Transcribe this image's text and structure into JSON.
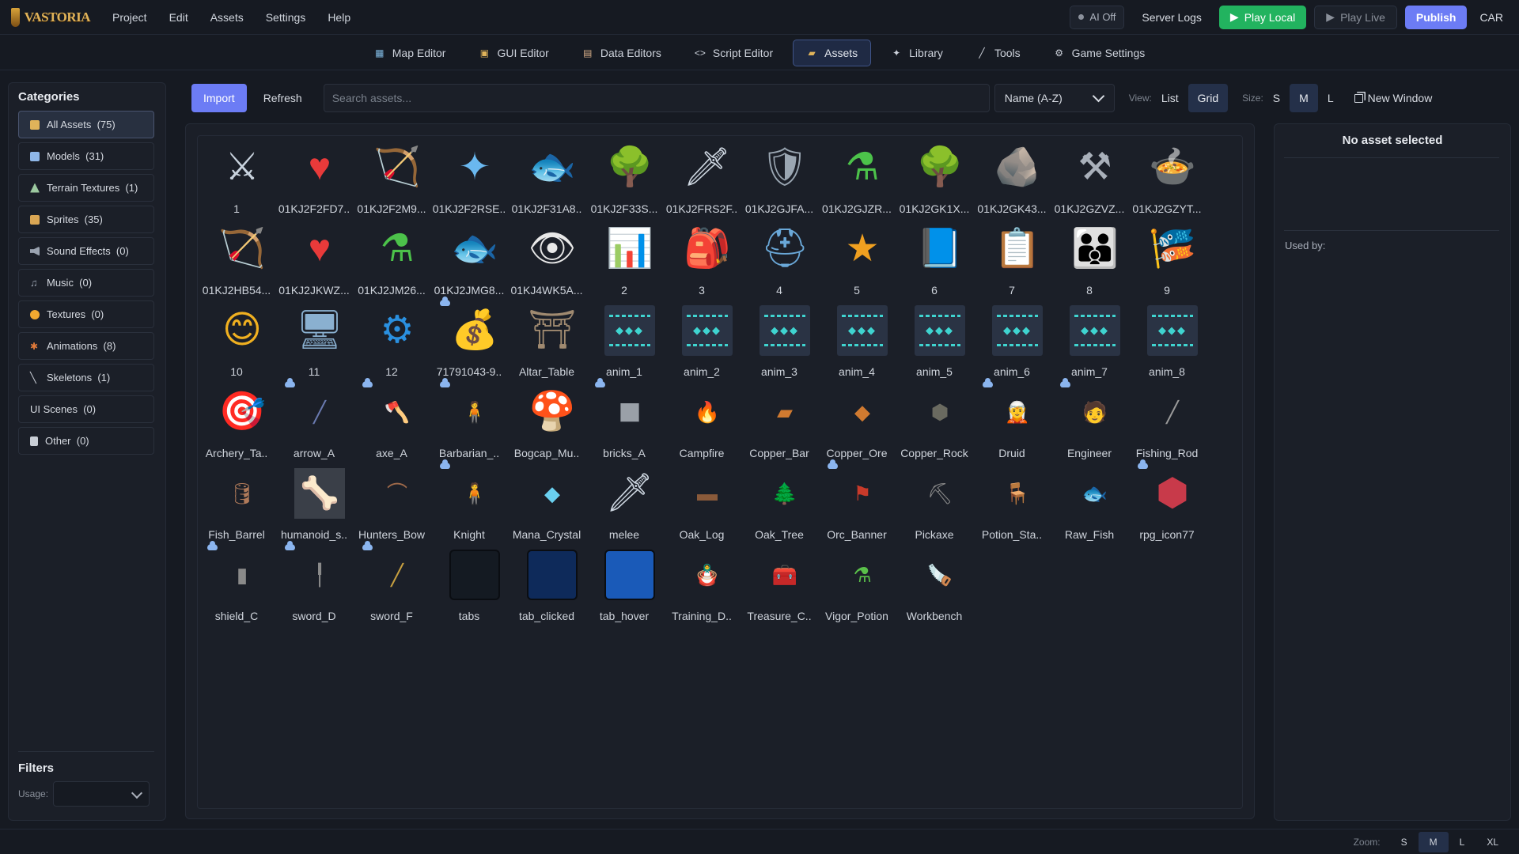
{
  "app": {
    "logo_text": "VASTORIA"
  },
  "menu": [
    "Project",
    "Edit",
    "Assets",
    "Settings",
    "Help"
  ],
  "right_menu": {
    "ai_toggle": "AI Off",
    "server_logs": "Server Logs",
    "play_local": "Play Local",
    "play_live": "Play Live",
    "publish": "Publish",
    "user": "CAR"
  },
  "tabs": [
    {
      "label": "Map Editor",
      "icon": "map-icon"
    },
    {
      "label": "GUI Editor",
      "icon": "gui-icon"
    },
    {
      "label": "Data Editors",
      "icon": "database-icon"
    },
    {
      "label": "Script Editor",
      "icon": "code-icon"
    },
    {
      "label": "Assets",
      "icon": "folder-icon",
      "active": true
    },
    {
      "label": "Library",
      "icon": "sparkle-icon"
    },
    {
      "label": "Tools",
      "icon": "wrench-icon"
    },
    {
      "label": "Game Settings",
      "icon": "gear-icon"
    }
  ],
  "sidebar": {
    "title": "Categories",
    "categories": [
      {
        "label": "All Assets  (75)",
        "icon": "folder-icon",
        "active": true,
        "color": "#e0b35a"
      },
      {
        "label": "Models  (31)",
        "icon": "cube-icon",
        "color": "#8fb7e8"
      },
      {
        "label": "Terrain Textures  (1)",
        "icon": "mountain-icon",
        "color": "#9cc9a0"
      },
      {
        "label": "Sprites  (35)",
        "icon": "image-icon",
        "color": "#d9a654"
      },
      {
        "label": "Sound Effects  (0)",
        "icon": "speaker-icon",
        "color": "#9aa3b0"
      },
      {
        "label": "Music  (0)",
        "icon": "music-icon",
        "color": "#9aa3b0"
      },
      {
        "label": "Textures  (0)",
        "icon": "palette-icon",
        "color": "#f0a830"
      },
      {
        "label": "Animations  (8)",
        "icon": "runner-icon",
        "color": "#e07a3a"
      },
      {
        "label": "Skeletons  (1)",
        "icon": "bone-icon",
        "color": "#c9ced6"
      },
      {
        "label": "UI Scenes  (0)",
        "icon": "",
        "color": ""
      },
      {
        "label": "Other  (0)",
        "icon": "document-icon",
        "color": "#c9ced6"
      }
    ],
    "filters_title": "Filters",
    "usage_label": "Usage:"
  },
  "asset_toolbar": {
    "import": "Import",
    "refresh": "Refresh",
    "search_placeholder": "Search assets...",
    "sort": "Name (A-Z)",
    "view_label": "View:",
    "view_list": "List",
    "view_grid": "Grid",
    "size_label": "Size:",
    "size_s": "S",
    "size_m": "M",
    "size_l": "L",
    "new_window": "New Window"
  },
  "assets": [
    {
      "name": "1",
      "icon": "crossed-swords-icon",
      "glyph": "⚔",
      "color": "#c9d3de"
    },
    {
      "name": "01KJ2F2FD7..",
      "icon": "heart-icon",
      "glyph": "♥",
      "color": "#e83a3a"
    },
    {
      "name": "01KJ2F2M9...",
      "icon": "bow-icon",
      "glyph": "🏹",
      "color": "#b07a3a"
    },
    {
      "name": "01KJ2F2RSE..",
      "icon": "magic-wand-icon",
      "glyph": "✦",
      "color": "#6ab8f0"
    },
    {
      "name": "01KJ2F31A8..",
      "icon": "fish-icon",
      "glyph": "🐟",
      "color": "#5aa8e8"
    },
    {
      "name": "01KJ2F33S...",
      "icon": "tree-icon",
      "glyph": "🌳",
      "color": "#4ca43e"
    },
    {
      "name": "01KJ2FRS2F..",
      "icon": "sword-icon",
      "glyph": "🗡",
      "color": "#cfd8e2"
    },
    {
      "name": "01KJ2GJFA...",
      "icon": "shield-icon",
      "glyph": "🛡",
      "color": "#9aa6b2"
    },
    {
      "name": "01KJ2GJZR...",
      "icon": "potion-icon",
      "glyph": "⚗",
      "color": "#4cc24a"
    },
    {
      "name": "01KJ2GK1X...",
      "icon": "tree-icon",
      "glyph": "🌳",
      "color": "#4ca43e"
    },
    {
      "name": "01KJ2GK43...",
      "icon": "ore-rock-icon",
      "glyph": "🪨",
      "color": "#9a8a7a"
    },
    {
      "name": "01KJ2GZVZ...",
      "icon": "hammer-icon",
      "glyph": "⚒",
      "color": "#a9b0ba"
    },
    {
      "name": "01KJ2GZYT...",
      "icon": "cauldron-icon",
      "glyph": "🍲",
      "color": "#3a3a3a"
    },
    {
      "name": "01KJ2HB54...",
      "icon": "bow-icon",
      "glyph": "🏹",
      "color": "#b07a3a"
    },
    {
      "name": "01KJ2JKWZ...",
      "icon": "heart-icon",
      "glyph": "♥",
      "color": "#e83a3a"
    },
    {
      "name": "01KJ2JM26...",
      "icon": "potion-icon",
      "glyph": "⚗",
      "color": "#4cc24a"
    },
    {
      "name": "01KJ2JMG8...",
      "icon": "fish-icon",
      "glyph": "🐟",
      "color": "#5aa8e8"
    },
    {
      "name": "01KJ4WK5A...",
      "icon": "eye-icon",
      "glyph": "👁",
      "color": "#e8e8e8"
    },
    {
      "name": "2",
      "icon": "bar-chart-icon",
      "glyph": "📊",
      "color": "#e8a020"
    },
    {
      "name": "3",
      "icon": "backpack-icon",
      "glyph": "🎒",
      "color": "#c47a30"
    },
    {
      "name": "4",
      "icon": "helmet-icon",
      "glyph": "⛑",
      "color": "#6aa8d8"
    },
    {
      "name": "5",
      "icon": "star-icon",
      "glyph": "★",
      "color": "#f0a020"
    },
    {
      "name": "6",
      "icon": "spellbook-icon",
      "glyph": "📘",
      "color": "#2a78d0"
    },
    {
      "name": "7",
      "icon": "checklist-icon",
      "glyph": "📋",
      "color": "#f0c040"
    },
    {
      "name": "8",
      "icon": "group-icon",
      "glyph": "👪",
      "color": "#e06a2a"
    },
    {
      "name": "9",
      "icon": "banner-icon",
      "glyph": "🎏",
      "color": "#c83a2a"
    },
    {
      "name": "10",
      "icon": "chat-smile-icon",
      "glyph": "😊",
      "color": "#f0b020"
    },
    {
      "name": "11",
      "icon": "monitor-icon",
      "glyph": "🖥",
      "color": "#8ab0d0"
    },
    {
      "name": "12",
      "icon": "gear-icon",
      "glyph": "⚙",
      "color": "#2a90e0"
    },
    {
      "name": "71791043-9..",
      "icon": "coin-bag-icon",
      "glyph": "💰",
      "color": "#c8902a",
      "cloud": true
    },
    {
      "name": "Altar_Table",
      "icon": "altar-icon",
      "glyph": "⛩",
      "color": "#a08a70"
    },
    {
      "name": "anim_1",
      "icon": "animation-card-icon",
      "card": true
    },
    {
      "name": "anim_2",
      "icon": "animation-card-icon",
      "card": true
    },
    {
      "name": "anim_3",
      "icon": "animation-card-icon",
      "card": true
    },
    {
      "name": "anim_4",
      "icon": "animation-card-icon",
      "card": true
    },
    {
      "name": "anim_5",
      "icon": "animation-card-icon",
      "card": true
    },
    {
      "name": "anim_6",
      "icon": "animation-card-icon",
      "card": true
    },
    {
      "name": "anim_7",
      "icon": "animation-card-icon",
      "card": true
    },
    {
      "name": "anim_8",
      "icon": "animation-card-icon",
      "card": true
    },
    {
      "name": "Archery_Ta..",
      "icon": "target-icon",
      "glyph": "🎯",
      "color": "#e04a4a"
    },
    {
      "name": "arrow_A",
      "icon": "arrow-icon",
      "glyph": "╱",
      "color": "#6a7ab0",
      "small": true,
      "cloud": true
    },
    {
      "name": "axe_A",
      "icon": "axe-icon",
      "glyph": "🪓",
      "color": "#8a8a8a",
      "small": true,
      "cloud": true
    },
    {
      "name": "Barbarian_..",
      "icon": "barbarian-icon",
      "glyph": "🧍",
      "color": "#8a7a6a",
      "small": true,
      "cloud": true
    },
    {
      "name": "Bogcap_Mu..",
      "icon": "mushroom-icon",
      "glyph": "🍄",
      "color": "#e04a3a"
    },
    {
      "name": "bricks_A",
      "icon": "cube-icon",
      "glyph": "■",
      "color": "#9aa0a8",
      "cloud": true
    },
    {
      "name": "Campfire",
      "icon": "campfire-icon",
      "glyph": "🔥",
      "color": "#b06a4a",
      "small": true
    },
    {
      "name": "Copper_Bar",
      "icon": "ingot-icon",
      "glyph": "▰",
      "color": "#d07a30",
      "small": true
    },
    {
      "name": "Copper_Ore",
      "icon": "ore-icon",
      "glyph": "◆",
      "color": "#d07a30",
      "small": true
    },
    {
      "name": "Copper_Rock",
      "icon": "rock-icon",
      "glyph": "⬢",
      "color": "#6a6a60",
      "small": true
    },
    {
      "name": "Druid",
      "icon": "druid-icon",
      "glyph": "🧝",
      "color": "#8a9a5a",
      "small": true,
      "cloud": true
    },
    {
      "name": "Engineer",
      "icon": "engineer-icon",
      "glyph": "🧑",
      "color": "#d08a40",
      "small": true,
      "cloud": true
    },
    {
      "name": "Fishing_Rod",
      "icon": "fishing-rod-icon",
      "glyph": "╱",
      "color": "#9a9a9a",
      "small": true
    },
    {
      "name": "Fish_Barrel",
      "icon": "barrel-icon",
      "glyph": "🛢",
      "color": "#b07a5a",
      "small": true
    },
    {
      "name": "humanoid_s..",
      "icon": "bone-icon",
      "glyph": "🦴",
      "color": "#e8e8e8",
      "boxed": true
    },
    {
      "name": "Hunters_Bow",
      "icon": "bow-icon",
      "glyph": "⌒",
      "color": "#a06a4a",
      "small": true
    },
    {
      "name": "Knight",
      "icon": "knight-icon",
      "glyph": "🧍",
      "color": "#9aa0a8",
      "small": true,
      "cloud": true
    },
    {
      "name": "Mana_Crystal",
      "icon": "crystal-icon",
      "glyph": "◆",
      "color": "#6ad0f0",
      "small": true
    },
    {
      "name": "melee",
      "icon": "sword-icon",
      "glyph": "🗡",
      "color": "#cfd8e2"
    },
    {
      "name": "Oak_Log",
      "icon": "log-icon",
      "glyph": "▬",
      "color": "#8a5a3a",
      "small": true
    },
    {
      "name": "Oak_Tree",
      "icon": "tree-icon",
      "glyph": "🌲",
      "color": "#4a9a4a",
      "small": true
    },
    {
      "name": "Orc_Banner",
      "icon": "banner-icon",
      "glyph": "⚑",
      "color": "#c83a2a",
      "small": true,
      "cloud": true
    },
    {
      "name": "Pickaxe",
      "icon": "pickaxe-icon",
      "glyph": "⛏",
      "color": "#8a8a8a",
      "small": true
    },
    {
      "name": "Potion_Sta..",
      "icon": "potion-stand-icon",
      "glyph": "🪑",
      "color": "#a06a4a",
      "small": true
    },
    {
      "name": "Raw_Fish",
      "icon": "fish-icon",
      "glyph": "🐟",
      "color": "#d0d8e0",
      "small": true
    },
    {
      "name": "rpg_icon77",
      "icon": "gem-icon",
      "glyph": "⬢",
      "color": "#c83a4a",
      "cloud": true
    },
    {
      "name": "shield_C",
      "icon": "shield-icon",
      "glyph": "▮",
      "color": "#8a8a8a",
      "small": true,
      "cloud": true
    },
    {
      "name": "sword_D",
      "icon": "sword-icon",
      "glyph": "╿",
      "color": "#8a8a8a",
      "small": true,
      "cloud": true
    },
    {
      "name": "sword_F",
      "icon": "sword-icon",
      "glyph": "╱",
      "color": "#c8a040",
      "small": true,
      "cloud": true
    },
    {
      "name": "tabs",
      "icon": "tab-swatch-icon",
      "swatch": "#141a22"
    },
    {
      "name": "tab_clicked",
      "icon": "tab-swatch-icon",
      "swatch": "#0e2a5a"
    },
    {
      "name": "tab_hover",
      "icon": "tab-swatch-icon",
      "swatch": "#1a5ab8"
    },
    {
      "name": "Training_D..",
      "icon": "training-dummy-icon",
      "glyph": "🪆",
      "color": "#d0b080",
      "small": true
    },
    {
      "name": "Treasure_C..",
      "icon": "chest-icon",
      "glyph": "🧰",
      "color": "#a08070",
      "small": true
    },
    {
      "name": "Vigor_Potion",
      "icon": "potion-icon",
      "glyph": "⚗",
      "color": "#5ac04a",
      "small": true
    },
    {
      "name": "Workbench",
      "icon": "workbench-icon",
      "glyph": "🪚",
      "color": "#a07a5a",
      "small": true
    }
  ],
  "detail": {
    "title": "No asset selected",
    "used_by": "Used by:"
  },
  "status": {
    "zoom_label": "Zoom:",
    "zoom_options": [
      "S",
      "M",
      "L",
      "XL"
    ],
    "zoom_active": "M"
  },
  "colors": {
    "accent": "#6c7cf5",
    "play_local": "#22b35f",
    "bg": "#161a22",
    "panel": "#1b1f28"
  }
}
